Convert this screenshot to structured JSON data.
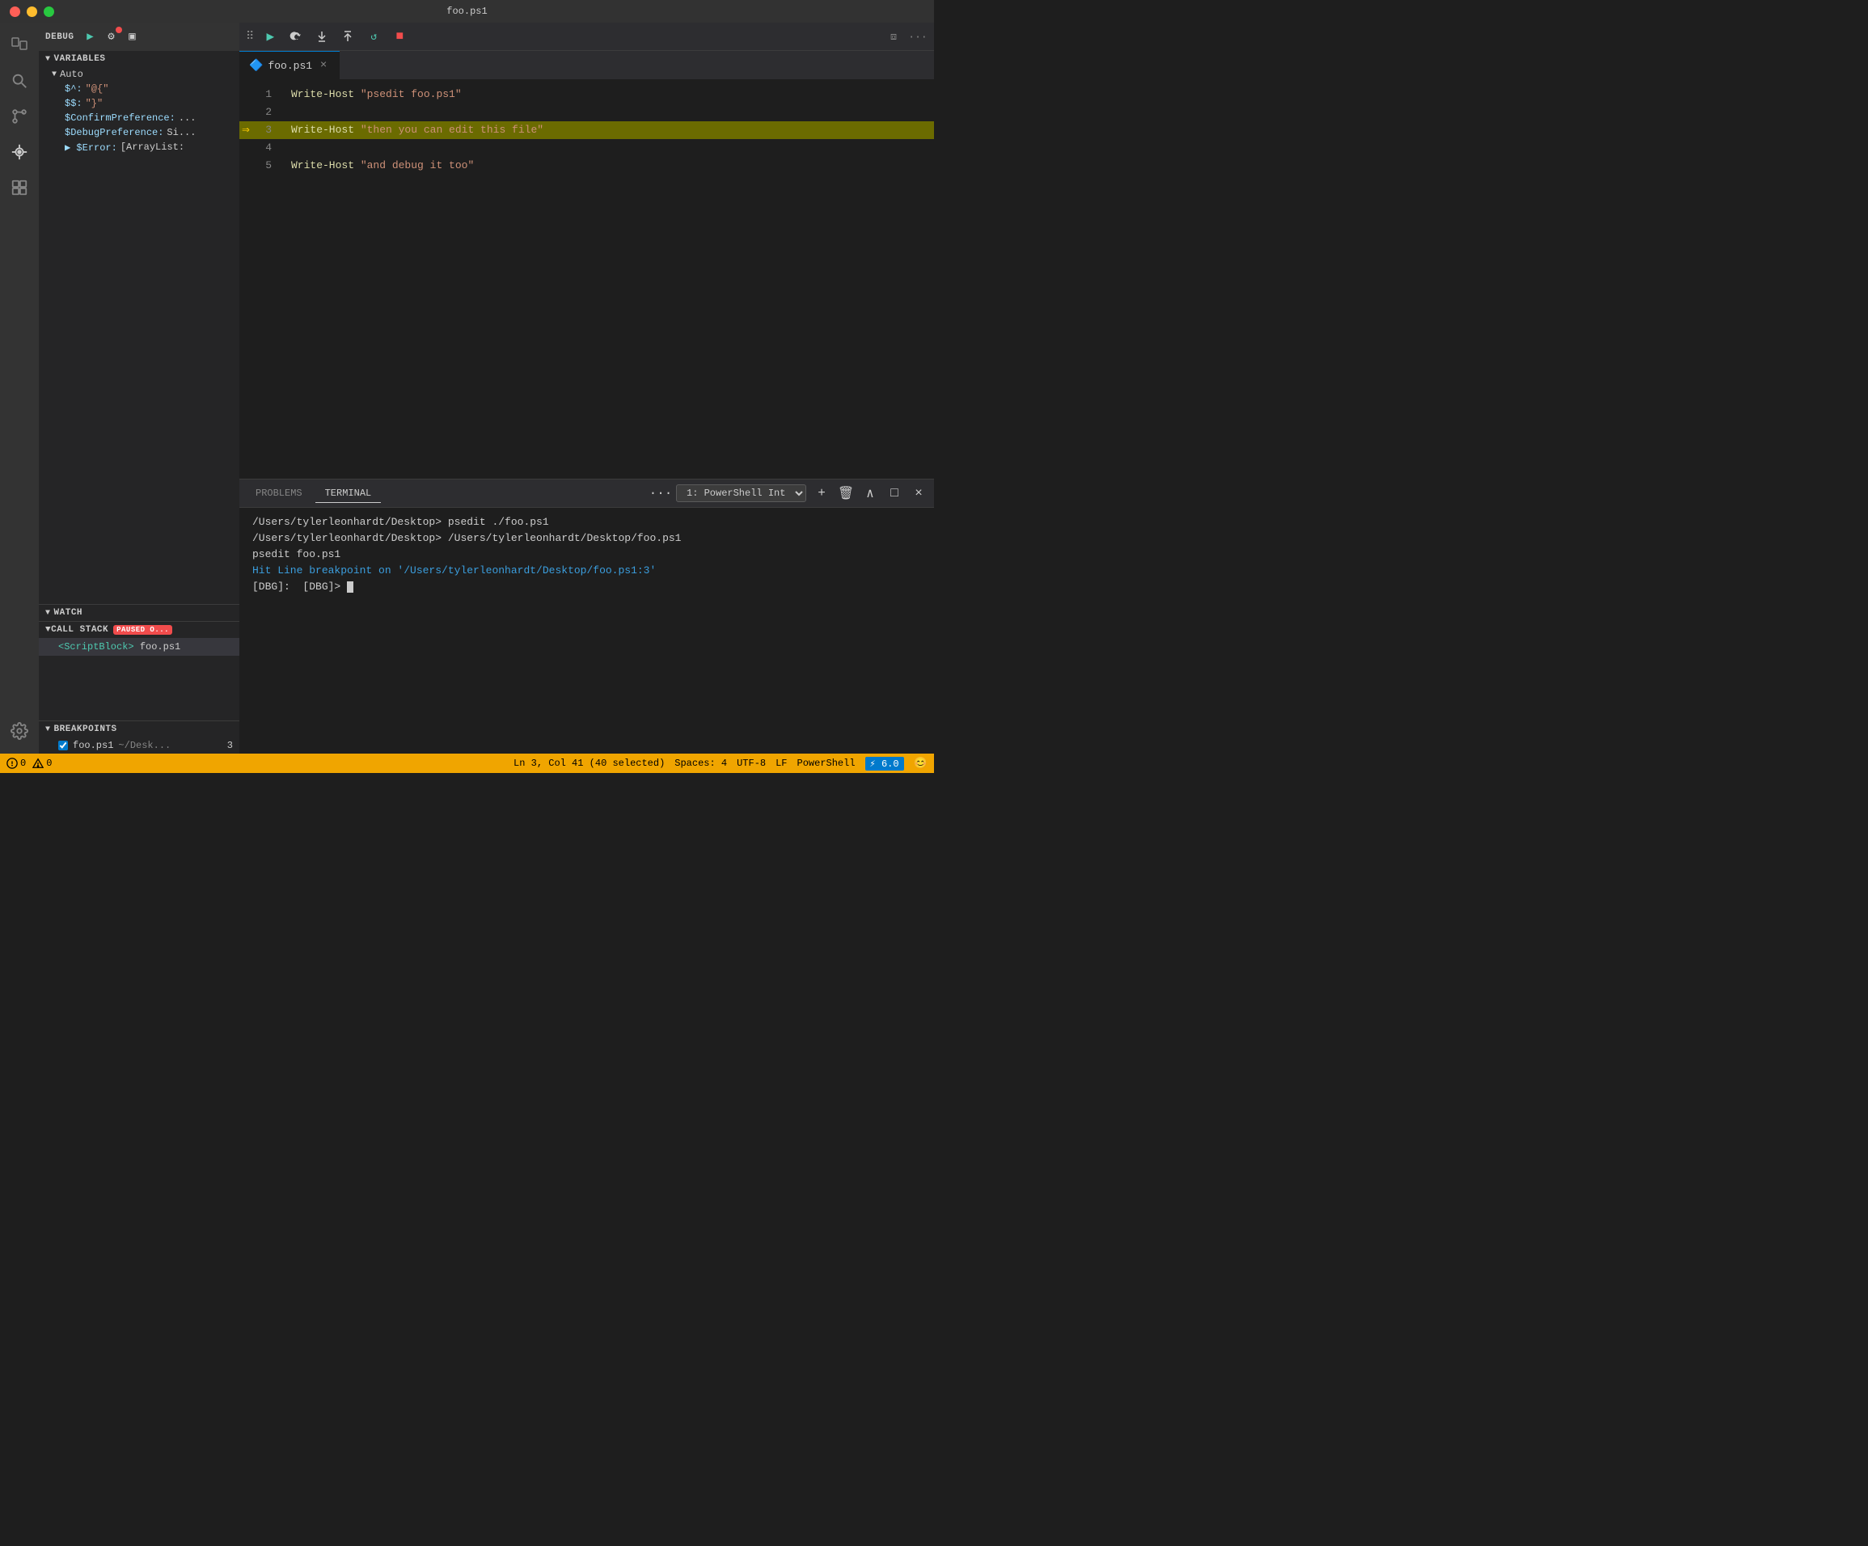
{
  "titlebar": {
    "title": "foo.ps1"
  },
  "activity_bar": {
    "icons": [
      {
        "name": "explorer-icon",
        "glyph": "⧉",
        "active": false
      },
      {
        "name": "search-icon",
        "glyph": "🔍",
        "active": false
      },
      {
        "name": "source-control-icon",
        "glyph": "⎇",
        "active": false
      },
      {
        "name": "debug-icon",
        "glyph": "🚫",
        "active": true
      },
      {
        "name": "extensions-icon",
        "glyph": "⊞",
        "active": false
      }
    ]
  },
  "debug_panel": {
    "label": "DEBUG",
    "sections": {
      "variables": "VARIABLES",
      "auto": "Auto",
      "watch": "WATCH",
      "call_stack": "CALL STACK",
      "paused": "PAUSED O...",
      "breakpoints": "BREAKPOINTS"
    },
    "variables": [
      {
        "name": "$^:",
        "value": "\"@{\""
      },
      {
        "name": "$$:",
        "value": "\"}\""
      },
      {
        "name": "$ConfirmPreference:",
        "value": "..."
      },
      {
        "name": "$DebugPreference:",
        "value": "Si..."
      },
      {
        "name": "$Error:",
        "value": "[ArrayList:"
      }
    ],
    "callstack": [
      {
        "script": "<ScriptBlock>",
        "file": "foo.ps1"
      }
    ],
    "breakpoints": [
      {
        "checked": true,
        "filename": "foo.ps1",
        "path": "~/Desk...",
        "line": "3"
      }
    ]
  },
  "editor": {
    "tab": {
      "icon": "ps1-icon",
      "filename": "foo.ps1",
      "close_label": "×"
    },
    "lines": [
      {
        "num": "1",
        "content": "Write-Host \"psedit foo.ps1\"",
        "highlighted": false,
        "breakpoint": false,
        "current": false
      },
      {
        "num": "2",
        "content": "",
        "highlighted": false,
        "breakpoint": false,
        "current": false
      },
      {
        "num": "3",
        "content": "Write-Host \"then you can edit this file\"",
        "highlighted": true,
        "breakpoint": true,
        "current": true
      },
      {
        "num": "4",
        "content": "",
        "highlighted": false,
        "breakpoint": false,
        "current": false
      },
      {
        "num": "5",
        "content": "Write-Host \"and debug it too\"",
        "highlighted": false,
        "breakpoint": false,
        "current": false
      }
    ]
  },
  "debug_action_bar": {
    "buttons": [
      {
        "name": "continue-btn",
        "label": "▶",
        "title": "Continue"
      },
      {
        "name": "step-over-btn",
        "label": "↷",
        "title": "Step Over"
      },
      {
        "name": "step-into-btn",
        "label": "↓",
        "title": "Step Into"
      },
      {
        "name": "step-out-btn",
        "label": "↑",
        "title": "Step Out"
      },
      {
        "name": "restart-btn",
        "label": "↺",
        "title": "Restart"
      },
      {
        "name": "stop-btn",
        "label": "■",
        "title": "Stop"
      }
    ]
  },
  "terminal": {
    "tabs": [
      {
        "label": "PROBLEMS",
        "active": false
      },
      {
        "label": "TERMINAL",
        "active": true
      }
    ],
    "dropdown": "1: PowerShell Int",
    "more_label": "···",
    "lines": [
      {
        "text": "/Users/tylerleonhardt/Desktop> psedit ./foo.ps1",
        "type": "normal"
      },
      {
        "text": "/Users/tylerleonhardt/Desktop> /Users/tylerleonhardt/Desktop/foo.ps1",
        "type": "normal"
      },
      {
        "text": "",
        "type": "normal"
      },
      {
        "text": "psedit foo.ps1",
        "type": "normal"
      },
      {
        "text": "",
        "type": "normal"
      },
      {
        "text": "Hit Line breakpoint on '/Users/tylerleonhardt/Desktop/foo.ps1:3'",
        "type": "blue"
      },
      {
        "text": "",
        "type": "normal"
      },
      {
        "text": "[DBG]:  [DBG]> ",
        "type": "normal",
        "has_cursor": true
      }
    ]
  },
  "status_bar": {
    "errors": "0",
    "warnings": "0",
    "position": "Ln 3, Col 41 (40 selected)",
    "spaces": "Spaces: 4",
    "encoding": "UTF-8",
    "line_ending": "LF",
    "language": "PowerShell",
    "version": "⚡ 6.0",
    "feedback_icon": "😊"
  }
}
